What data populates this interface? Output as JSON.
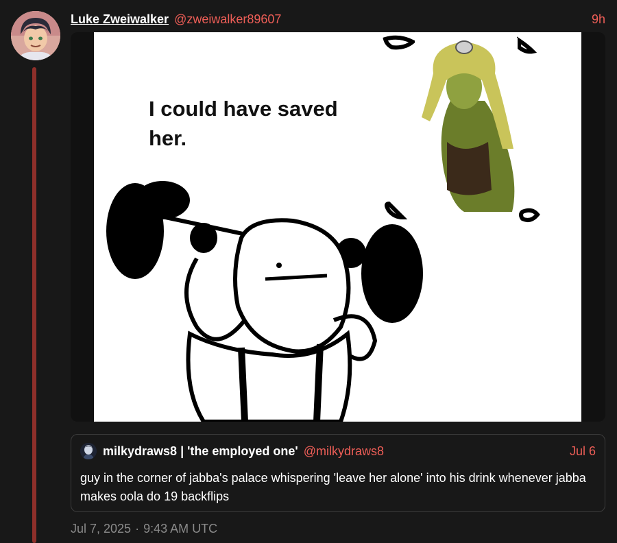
{
  "post": {
    "author_name": "Luke Zweiwalker",
    "author_handle": "@zweiwalker89607",
    "time": "9h",
    "footer_date": "Jul 7, 2025",
    "footer_separator": "·",
    "footer_time": "9:43 AM UTC"
  },
  "media": {
    "caption_line1": "I could have saved",
    "caption_line2": "her."
  },
  "quote": {
    "author_name": "milkydraws8 | 'the employed one'",
    "author_handle": "@milkydraws8",
    "date": "Jul 6",
    "text": "guy in the corner of jabba's palace whispering 'leave her alone' into his drink whenever jabba makes oola do 19 backflips"
  },
  "colors": {
    "background": "#181818",
    "accent": "#ee5e57",
    "thread_line": "#8e2f2a",
    "muted": "#8a8a8a"
  },
  "icons": {
    "post_avatar": "user-avatar",
    "quote_avatar": "user-avatar"
  }
}
